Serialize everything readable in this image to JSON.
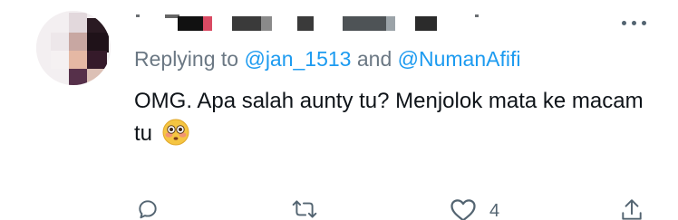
{
  "tweet": {
    "replying_prefix": "Replying to ",
    "mention_1": "@jan_1513",
    "conjunction": " and ",
    "mention_2": "@NumanAfifi",
    "text": "OMG. Apa salah aunty tu? Menjolok mata ke macam tu",
    "emoji": "flushed-face-emoji"
  },
  "actions": {
    "reply_icon": "reply-icon",
    "retweet_icon": "retweet-icon",
    "like_icon": "heart-icon",
    "like_count": "4",
    "share_icon": "share-icon",
    "more_icon": "more-options-icon"
  },
  "colors": {
    "link": "#1d9bf0",
    "secondary_text": "#6b7884",
    "icon": "#536471",
    "text": "#0f1419"
  }
}
